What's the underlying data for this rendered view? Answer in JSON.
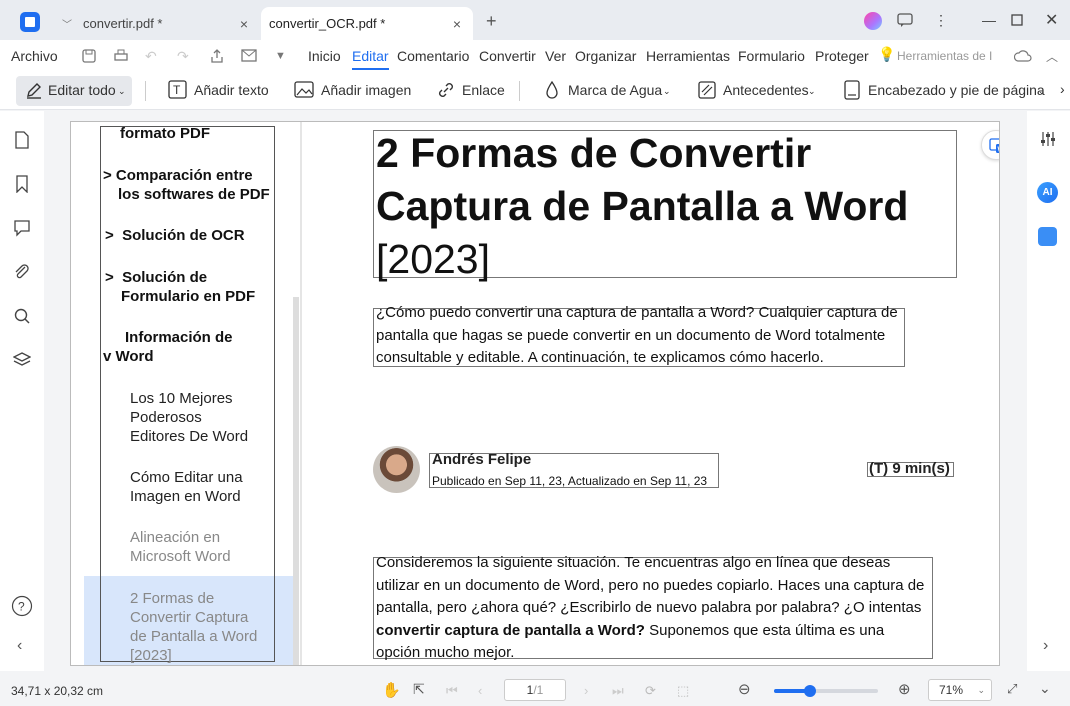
{
  "window": {
    "tabs": [
      {
        "label": "convertir.pdf *",
        "close": "×"
      },
      {
        "label": "convertir_OCR.pdf *",
        "close": "×"
      }
    ],
    "new_tab": "+"
  },
  "menu": {
    "file": "Archivo",
    "items": [
      "Inicio",
      "Editar",
      "Comentario",
      "Convertir",
      "Ver",
      "Organizar",
      "Herramientas",
      "Formulario",
      "Proteger"
    ],
    "tools_search": "Herramientas de I"
  },
  "toolbar": {
    "edit_all": "Editar todo",
    "add_text": "Añadir texto",
    "add_image": "Añadir imagen",
    "link": "Enlace",
    "watermark": "Marca de Agua",
    "background": "Antecedentes",
    "header_footer": "Encabezado y pie de página"
  },
  "toc": {
    "items": [
      "formato PDF",
      "> Comparación entre",
      "los softwares de PDF",
      ">  Solución de OCR",
      ">  Solución de",
      "Formulario en PDF",
      "Información de",
      "v Word"
    ],
    "subitems": [
      [
        "Los 10 Mejores",
        "Poderosos",
        "Editores De Word"
      ],
      [
        "Cómo Editar una",
        "Imagen en Word"
      ],
      [
        "Alineación en",
        "Microsoft Word"
      ],
      [
        "2 Formas de",
        "Convertir Captura",
        "de Pantalla a Word",
        "[2023]"
      ]
    ]
  },
  "article": {
    "title_line1": "2 Formas de Convertir",
    "title_line2": "Captura de Pantalla a Word",
    "title_line3": "[2023]",
    "intro": [
      "¿Cómo puedo convertir una captura de pantalla a Word? Cualquier captura de",
      "pantalla que hagas se puede convertir en un documento de Word totalmente",
      "consultable y editable. A continuación, te explicamos cómo hacerlo."
    ],
    "author": "Andrés Felipe",
    "published": "Publicado en Sep 11, 23, Actualizado en Sep 11, 23",
    "read_time": "(T) 9 min(s)",
    "body": [
      "Consideremos la siguiente situación. Te encuentras algo en línea que deseas",
      "utilizar en un documento de Word, pero no puedes copiarlo. Haces una captura de",
      "pantalla, pero ¿ahora qué? ¿Escribirlo de nuevo palabra por palabra? ¿O intentas"
    ],
    "body_bold": "convertir captura de pantalla a Word?",
    "body_rest": " Suponemos que esta última es una",
    "body_last": "opción mucho mejor."
  },
  "status": {
    "dimensions": "34,71 x 20,32 cm",
    "page": "1",
    "page_total": "/1",
    "zoom": "71%",
    "zoom_level": 0.35
  },
  "colors": {
    "accent": "#1f6ef0",
    "highlight": "#d8e6fb"
  }
}
